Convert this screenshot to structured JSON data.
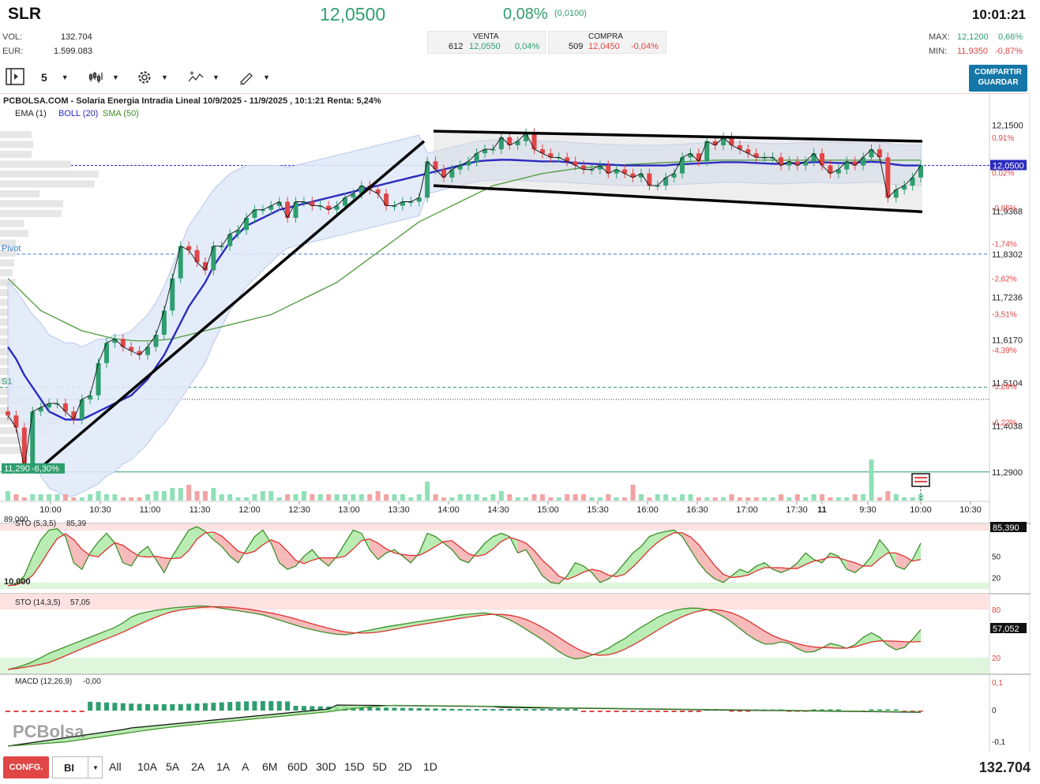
{
  "header": {
    "symbol": "SLR",
    "last_price": "12,0500",
    "change_pct": "0,08%",
    "change_abs": "(0,0100)",
    "time": "10:01:21",
    "vol_label": "VOL:",
    "vol_value": "132.704",
    "eur_label": "EUR:",
    "eur_value": "1.599.083",
    "sell_label": "VENTA",
    "sell_qty": "612",
    "sell_price": "12,0550",
    "sell_pct": "0,04%",
    "buy_label": "COMPRA",
    "buy_qty": "509",
    "buy_price": "12,0450",
    "buy_pct": "-0,04%",
    "max_label": "MAX:",
    "max_value": "12,1200",
    "max_pct": "0,66%",
    "min_label": "MIN:",
    "min_value": "11,9350",
    "min_pct": "-0,87%"
  },
  "toolbar": {
    "interval": "5",
    "share_line1": "COMPARTIR",
    "share_line2": "GUARDAR"
  },
  "chart_data": {
    "type": "line",
    "title": "PCBOLSA.COM - Solaria Energia Intradia Lineal 10/9/2025 - 11/9/2025 , 10:1:21 Renta: 5,24%",
    "indicators_label": {
      "ema": "EMA (1)",
      "boll": "BOLL (20)",
      "sma": "SMA (50)"
    },
    "y_ticks": [
      "12,1500",
      "11,9368",
      "11,8302",
      "11,7236",
      "11,6170",
      "11,5104",
      "11,4038",
      "11,2900"
    ],
    "y_tick_values": [
      12.15,
      11.9368,
      11.8302,
      11.7236,
      11.617,
      11.5104,
      11.4038,
      11.29
    ],
    "y_pct_labels": [
      "0,91%",
      "0,02%",
      "-0,85%",
      "-1,74%",
      "-2,62%",
      "-3,51%",
      "-4,39%",
      "-5,28%",
      "-6,22%"
    ],
    "current_label": "12,0500",
    "pivot_label": "Pivot",
    "s1_label": "S1",
    "low_label": "11,290",
    "low_pct": "-6,30%",
    "x_ticks": [
      "10:00",
      "10:30",
      "11:00",
      "11:30",
      "12:00",
      "12:30",
      "13:00",
      "13:30",
      "14:00",
      "14:30",
      "15:00",
      "15:30",
      "16:00",
      "16:30",
      "17:00",
      "17:30",
      "11",
      "9:30",
      "10:00",
      "10:30"
    ],
    "ylim": [
      11.27,
      12.19
    ],
    "close": [
      11.43,
      11.4,
      11.3,
      11.44,
      11.45,
      11.46,
      11.46,
      11.44,
      11.42,
      11.47,
      11.48,
      11.56,
      11.61,
      11.62,
      11.6,
      11.59,
      11.58,
      11.6,
      11.63,
      11.69,
      11.77,
      11.85,
      11.84,
      11.81,
      11.79,
      11.85,
      11.85,
      11.88,
      11.89,
      11.92,
      11.94,
      11.94,
      11.95,
      11.96,
      11.92,
      11.96,
      11.96,
      11.95,
      11.95,
      11.94,
      11.95,
      11.97,
      11.98,
      12.0,
      11.99,
      11.98,
      11.95,
      11.95,
      11.96,
      11.96,
      11.97,
      12.06,
      12.04,
      12.02,
      12.04,
      12.05,
      12.06,
      12.08,
      12.09,
      12.09,
      12.12,
      12.1,
      12.11,
      12.13,
      12.09,
      12.08,
      12.07,
      12.07,
      12.06,
      12.05,
      12.04,
      12.04,
      12.05,
      12.03,
      12.04,
      12.03,
      12.02,
      12.03,
      12.0,
      12.0,
      12.02,
      12.03,
      12.07,
      12.08,
      12.06,
      12.11,
      12.1,
      12.12,
      12.1,
      12.09,
      12.08,
      12.07,
      12.07,
      12.07,
      12.05,
      12.06,
      12.05,
      12.06,
      12.08,
      12.05,
      12.03,
      12.04,
      12.06,
      12.05,
      12.07,
      12.09,
      12.07,
      11.97,
      11.99,
      12.0,
      12.02,
      12.05
    ],
    "ema_mid": [
      11.6,
      11.57,
      11.53,
      11.5,
      11.47,
      11.44,
      11.43,
      11.42,
      11.42,
      11.42,
      11.43,
      11.44,
      11.45,
      11.46,
      11.47,
      11.48,
      11.5,
      11.52,
      11.55,
      11.58,
      11.62,
      11.66,
      11.7,
      11.73,
      11.76,
      11.8,
      11.83,
      11.86,
      11.88,
      11.9,
      11.91,
      11.92,
      11.93,
      11.94,
      11.945,
      11.95,
      11.955,
      11.96,
      11.965,
      11.97,
      11.975,
      11.98,
      11.985,
      11.99,
      11.995,
      12.0,
      12.005,
      12.01,
      12.015,
      12.02,
      12.025,
      12.03,
      12.035,
      12.04,
      12.045,
      12.05,
      12.055,
      12.06,
      12.062,
      12.063,
      12.064,
      12.064,
      12.063,
      12.062,
      12.061,
      12.06,
      12.06,
      12.06,
      12.058,
      12.056,
      12.055,
      12.054,
      12.053,
      12.052,
      12.051,
      12.05,
      12.05,
      12.05,
      12.05,
      12.05,
      12.05,
      12.052,
      12.053,
      12.054,
      12.055,
      12.056,
      12.057,
      12.058,
      12.058,
      12.058,
      12.057,
      12.056,
      12.055,
      12.054,
      12.054,
      12.055,
      12.056,
      12.057,
      12.058,
      12.058,
      12.057,
      12.056,
      12.056,
      12.057,
      12.058,
      12.059,
      12.058,
      12.055,
      12.052,
      12.05,
      12.05,
      12.05
    ],
    "sma": [
      11.77,
      11.75,
      11.73,
      11.71,
      11.69,
      11.68,
      11.67,
      11.66,
      11.65,
      11.64,
      11.635,
      11.63,
      11.625,
      11.62,
      11.618,
      11.616,
      11.615,
      11.615,
      11.616,
      11.618,
      11.62,
      11.625,
      11.63,
      11.635,
      11.64,
      11.645,
      11.65,
      11.655,
      11.66,
      11.665,
      11.67,
      11.675,
      11.68,
      11.69,
      11.7,
      11.71,
      11.72,
      11.73,
      11.74,
      11.75,
      11.76,
      11.775,
      11.79,
      11.805,
      11.82,
      11.835,
      11.85,
      11.865,
      11.88,
      11.895,
      11.91,
      11.92,
      11.93,
      11.94,
      11.95,
      11.96,
      11.97,
      11.98,
      11.99,
      12.0,
      12.005,
      12.01,
      12.015,
      12.02,
      12.025,
      12.03,
      12.033,
      12.036,
      12.039,
      12.042,
      12.044,
      12.046,
      12.048,
      12.05,
      12.051,
      12.052,
      12.053,
      12.054,
      12.055,
      12.056,
      12.057,
      12.058,
      12.059,
      12.06,
      12.061,
      12.062,
      12.063,
      12.063,
      12.063,
      12.063,
      12.063,
      12.063,
      12.063,
      12.063,
      12.063,
      12.063,
      12.063,
      12.063,
      12.063,
      12.063,
      12.063,
      12.063,
      12.063,
      12.063,
      12.063,
      12.063,
      12.063,
      12.063,
      12.063,
      12.063,
      12.063,
      12.063
    ],
    "volume": [
      3,
      2,
      1,
      2,
      2,
      2,
      2,
      2,
      1,
      1,
      2,
      3,
      2,
      2,
      1,
      1,
      1,
      2,
      3,
      3,
      4,
      4,
      5,
      3,
      3,
      4,
      2,
      2,
      1,
      1,
      2,
      3,
      3,
      1,
      2,
      2,
      3,
      2,
      2,
      2,
      2,
      2,
      2,
      2,
      2,
      3,
      2,
      2,
      2,
      1,
      2,
      6,
      2,
      1,
      1,
      2,
      2,
      2,
      1,
      2,
      3,
      2,
      1,
      1,
      2,
      2,
      1,
      1,
      2,
      2,
      2,
      1,
      1,
      2,
      1,
      1,
      5,
      2,
      1,
      2,
      2,
      1,
      2,
      2,
      1,
      1,
      1,
      1,
      2,
      1,
      1,
      1,
      1,
      1,
      2,
      1,
      2,
      1,
      2,
      2,
      1,
      1,
      1,
      2,
      2,
      13,
      1,
      3,
      2,
      1,
      1,
      1,
      2,
      2,
      1,
      1,
      1,
      1
    ],
    "stoch1": {
      "label": "STO (5,3,5)",
      "value": "85,39",
      "badge": "85,390",
      "top_label": "89,000",
      "bottom_label": "10,000",
      "levels": [
        "50",
        "20"
      ]
    },
    "stoch2": {
      "label": "STO (14,3,5)",
      "value": "57,05",
      "badge": "57,052",
      "levels": [
        "80",
        "50",
        "20"
      ]
    },
    "macd": {
      "label": "MACD (12,26,9)",
      "value": "-0,00",
      "levels": [
        "0,1",
        "0",
        "-0,1"
      ]
    },
    "watermark": "PCBolsa"
  },
  "bottom": {
    "config_label": "CONFG.",
    "select_value": "BI",
    "ranges": [
      "All",
      "10A",
      "5A",
      "2A",
      "1A",
      "A",
      "6M",
      "60D",
      "30D",
      "15D",
      "5D",
      "2D",
      "1D"
    ],
    "volume_total": "132.704"
  }
}
